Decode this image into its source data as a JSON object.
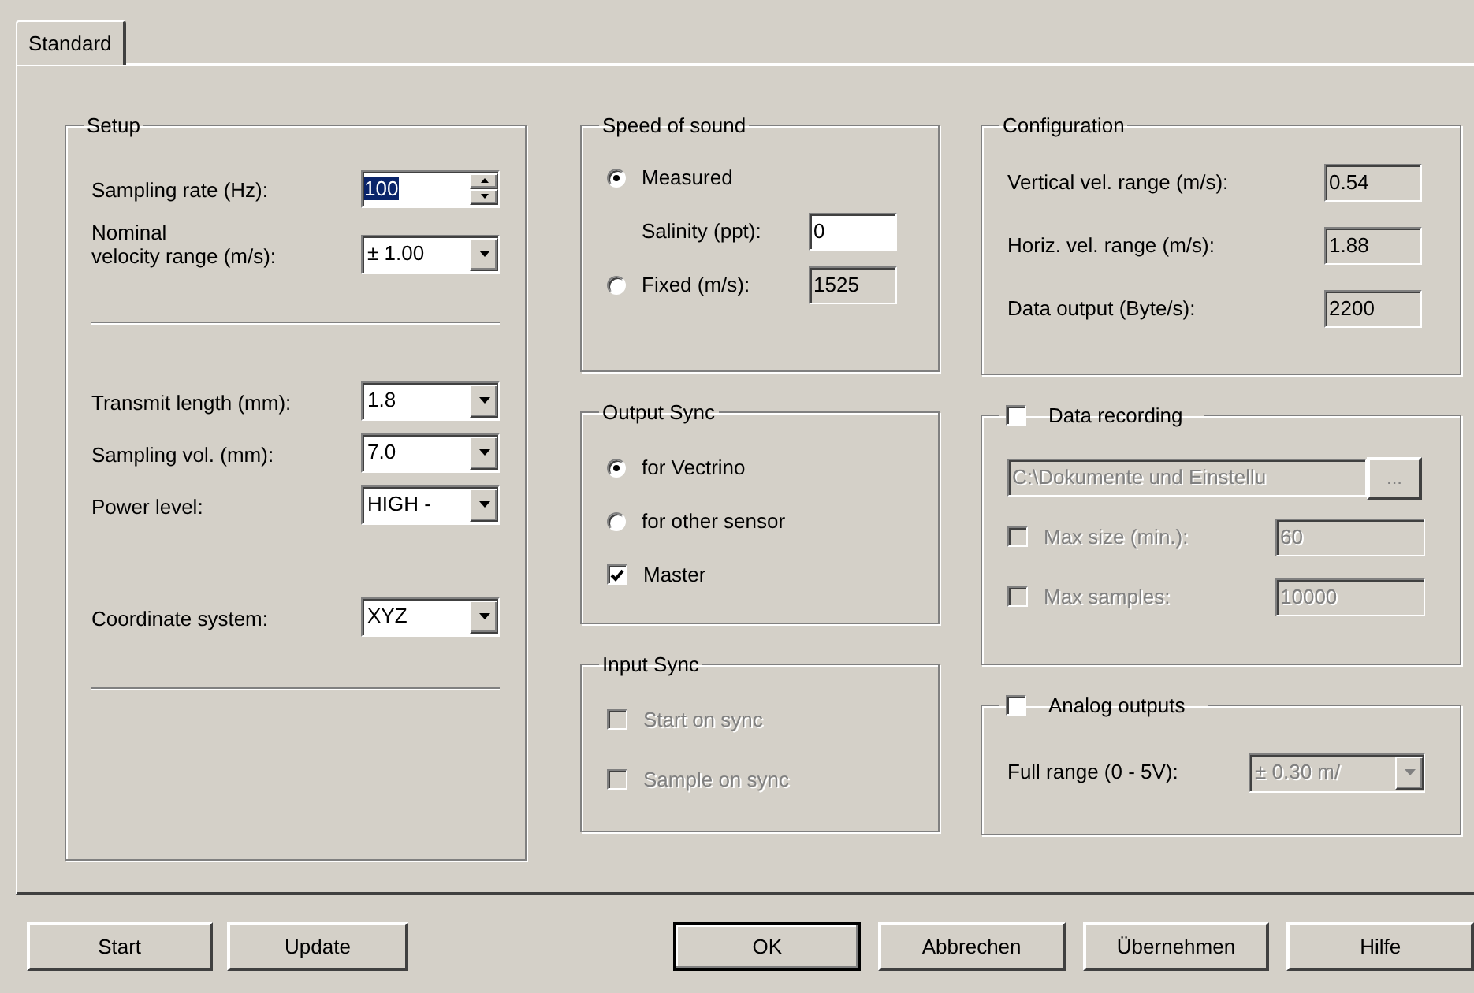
{
  "tabs": [
    {
      "label": "Standard",
      "selected": true
    }
  ],
  "setup": {
    "title": "Setup",
    "sections": [
      {
        "rows": [
          {
            "kind": "spin",
            "label": "Sampling rate (Hz):",
            "value": "100",
            "highlighted": true
          },
          {
            "kind": "combo",
            "label": "Nominal\nvelocity range (m/s):",
            "value": "± 1.00"
          }
        ]
      },
      {
        "rows": [
          {
            "kind": "combo",
            "label": "Transmit length (mm):",
            "value": "1.8"
          },
          {
            "kind": "combo",
            "label": "Sampling vol. (mm):",
            "value": "7.0"
          },
          {
            "kind": "combo",
            "label": "Power level:",
            "value": "HIGH -"
          }
        ]
      },
      {
        "rows": [
          {
            "kind": "combo",
            "label": "Coordinate system:",
            "value": "XYZ"
          }
        ]
      }
    ]
  },
  "speed_of_sound": {
    "title": "Speed of sound",
    "items": [
      {
        "kind": "radio",
        "label": "Measured",
        "selected": true
      },
      {
        "kind": "field",
        "label": "Salinity (ppt):",
        "value": "0",
        "readonly": false
      },
      {
        "kind": "radio",
        "label": "Fixed (m/s):",
        "selected": false,
        "value": "1525",
        "readonly": true
      }
    ]
  },
  "output_sync": {
    "title": "Output Sync",
    "items": [
      {
        "kind": "radio",
        "label": "for Vectrino",
        "selected": true
      },
      {
        "kind": "radio",
        "label": "for other sensor",
        "selected": false
      },
      {
        "kind": "checkbox",
        "label": "Master",
        "checked": true,
        "disabled": false
      }
    ]
  },
  "input_sync": {
    "title": "Input Sync",
    "items": [
      {
        "kind": "checkbox",
        "label": "Start on sync",
        "checked": false,
        "disabled": true
      },
      {
        "kind": "checkbox",
        "label": "Sample on sync",
        "checked": false,
        "disabled": true
      }
    ]
  },
  "configuration": {
    "title": "Configuration",
    "rows": [
      {
        "label": "Vertical vel. range (m/s):",
        "value": "0.54"
      },
      {
        "label": "Horiz. vel. range (m/s):",
        "value": "1.88"
      },
      {
        "label": "Data output (Byte/s):",
        "value": "2200"
      }
    ]
  },
  "data_recording": {
    "title": "Data recording",
    "checked": false,
    "path": "C:\\Dokumente und Einstellu",
    "browse": "...",
    "rows": [
      {
        "label": "Max size (min.):",
        "value": "60",
        "checked": false,
        "disabled": true
      },
      {
        "label": "Max samples:",
        "value": "10000",
        "checked": false,
        "disabled": true
      }
    ]
  },
  "analog_outputs": {
    "title": "Analog outputs",
    "checked": false,
    "label": "Full range (0 - 5V):",
    "value": "± 0.30 m/",
    "disabled": true
  },
  "buttons": [
    {
      "label": "Start",
      "default": false
    },
    {
      "label": "Update",
      "default": false
    },
    {
      "label": "OK",
      "default": true
    },
    {
      "label": "Abbrechen",
      "default": false
    },
    {
      "label": "Übernehmen",
      "default": false
    },
    {
      "label": "Hilfe",
      "default": false
    }
  ]
}
